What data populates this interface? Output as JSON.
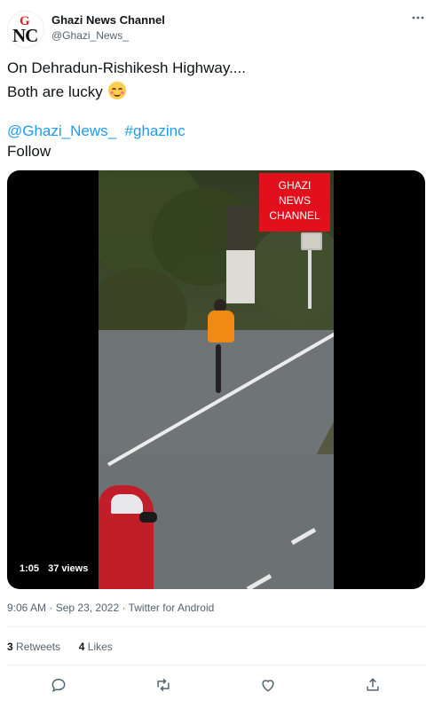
{
  "author": {
    "avatar_text_top": "G",
    "avatar_text_bottom": "NC",
    "name": "Ghazi News Channel",
    "handle": "@Ghazi_News_"
  },
  "more_icon": "more-horizontal-icon",
  "tweet": {
    "line1": "On Dehradun-Rishikesh Highway....",
    "line2": "Both are  lucky",
    "emoji": "smiling-face-with-blush-emoji",
    "mention": "@Ghazi_News_",
    "hashtag": "#ghazinc",
    "line4": "Follow"
  },
  "video": {
    "overlay_line1": "GHAZI",
    "overlay_line2": "NEWS",
    "overlay_line3": "CHANNEL",
    "duration": "1:05",
    "views": "37 views"
  },
  "meta": {
    "time": "9:06 AM",
    "date": "Sep 23, 2022",
    "source": "Twitter for Android",
    "separator": "·"
  },
  "stats": {
    "retweets_count": "3",
    "retweets_label": "Retweets",
    "likes_count": "4",
    "likes_label": "Likes"
  },
  "actions": [
    "reply-icon",
    "retweet-icon",
    "like-icon",
    "share-icon"
  ],
  "colors": {
    "link": "#1d9bf0",
    "secondary_text": "#536471",
    "brand_red": "#e2101d"
  }
}
